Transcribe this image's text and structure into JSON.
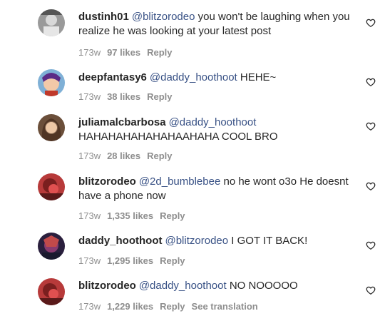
{
  "comments": [
    {
      "username": "dustinh01",
      "mention": "@blitzorodeo",
      "text": " you won't be laughing when you realize he was looking at your latest post",
      "time": "173w",
      "likes": "97 likes",
      "reply": "Reply"
    },
    {
      "username": "deepfantasy6",
      "mention": "@daddy_hoothoot",
      "text": " HEHE~",
      "time": "173w",
      "likes": "38 likes",
      "reply": "Reply"
    },
    {
      "username": "juliamalcbarbosa",
      "mention": "@daddy_hoothoot",
      "text": " HAHAHAHAHAHAHAAHAHA COOL BRO",
      "time": "173w",
      "likes": "28 likes",
      "reply": "Reply"
    },
    {
      "username": "blitzorodeo",
      "mention": "@2d_bumblebee",
      "text": " no he wont o3o He doesnt have a phone now",
      "time": "173w",
      "likes": "1,335 likes",
      "reply": "Reply"
    },
    {
      "username": "daddy_hoothoot",
      "mention": "@blitzorodeo",
      "text": " I GOT IT BACK!",
      "time": "173w",
      "likes": "1,295 likes",
      "reply": "Reply"
    },
    {
      "username": "blitzorodeo",
      "mention": "@daddy_hoothoot",
      "text": " NO NOOOOO",
      "time": "173w",
      "likes": "1,229 likes",
      "reply": "Reply",
      "see_translation": "See translation"
    }
  ],
  "icons": {
    "like": "heart-outline-icon"
  },
  "colors": {
    "text": "#262626",
    "mention": "#385185",
    "meta": "#8e8e8e"
  }
}
